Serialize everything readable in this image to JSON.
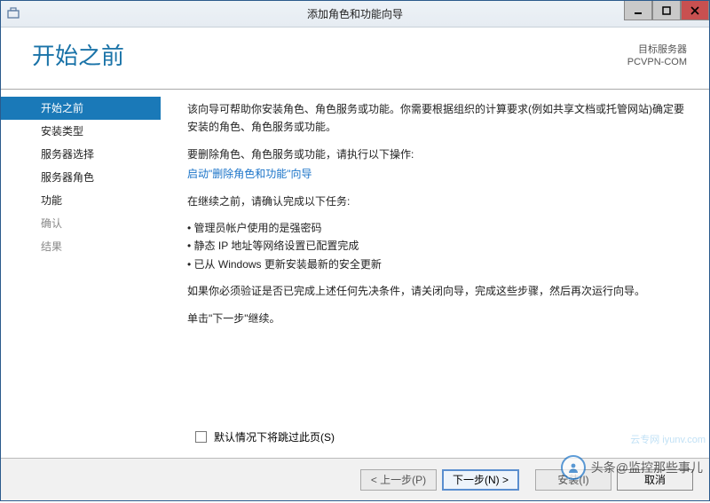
{
  "window": {
    "title": "添加角色和功能向导"
  },
  "header": {
    "page_title": "开始之前",
    "target_label": "目标服务器",
    "target_server": "PCVPN-COM"
  },
  "sidebar": {
    "items": [
      {
        "label": "开始之前",
        "selected": true,
        "enabled": true
      },
      {
        "label": "安装类型",
        "selected": false,
        "enabled": true
      },
      {
        "label": "服务器选择",
        "selected": false,
        "enabled": true
      },
      {
        "label": "服务器角色",
        "selected": false,
        "enabled": true
      },
      {
        "label": "功能",
        "selected": false,
        "enabled": true
      },
      {
        "label": "确认",
        "selected": false,
        "enabled": false
      },
      {
        "label": "结果",
        "selected": false,
        "enabled": false
      }
    ]
  },
  "content": {
    "intro": "该向导可帮助你安装角色、角色服务或功能。你需要根据组织的计算要求(例如共享文档或托管网站)确定要安装的角色、角色服务或功能。",
    "remove_prompt": "要删除角色、角色服务或功能，请执行以下操作:",
    "remove_link": "启动\"删除角色和功能\"向导",
    "pre_tasks_heading": "在继续之前，请确认完成以下任务:",
    "bullets": [
      "管理员帐户使用的是强密码",
      "静态 IP 地址等网络设置已配置完成",
      "已从 Windows 更新安装最新的安全更新"
    ],
    "verify_note": "如果你必须验证是否已完成上述任何先决条件，请关闭向导，完成这些步骤，然后再次运行向导。",
    "continue_note": "单击\"下一步\"继续。",
    "skip_checkbox": "默认情况下将跳过此页(S)"
  },
  "footer": {
    "prev": "< 上一步(P)",
    "next": "下一步(N) >",
    "install": "安装(I)",
    "cancel": "取消"
  },
  "watermark": {
    "text": "头条@监控那些事儿",
    "cloud": "云专网\niyunv.com"
  }
}
